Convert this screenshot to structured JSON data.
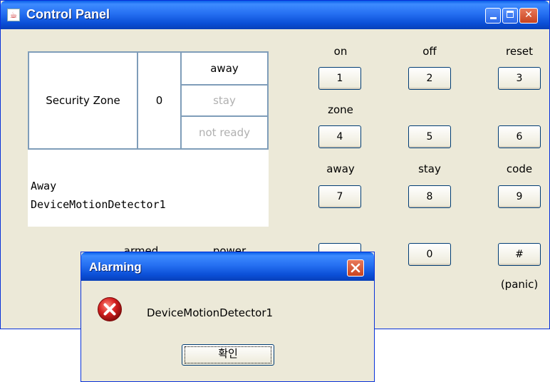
{
  "window": {
    "title": "Control Panel",
    "app_icon": "java-cup-icon"
  },
  "status": {
    "zone_label": "Security Zone",
    "zone_number": "0",
    "away": "away",
    "stay": "stay",
    "not_ready": "not ready",
    "message_line1": "Away",
    "message_line2": "DeviceMotionDetector1",
    "armed_label": "armed",
    "power_label": "power"
  },
  "keypad": {
    "labels": {
      "on": "on",
      "off": "off",
      "reset": "reset",
      "zone": "zone",
      "away": "away",
      "stay": "stay",
      "code": "code",
      "panic": "(panic)"
    },
    "keys": {
      "k1": "1",
      "k2": "2",
      "k3": "3",
      "k4": "4",
      "k5": "5",
      "k6": "6",
      "k7": "7",
      "k8": "8",
      "k9": "9",
      "k0": "0",
      "hash": "#"
    }
  },
  "dialog": {
    "title": "Alarming",
    "message": "DeviceMotionDetector1",
    "ok_label": "확인",
    "icon": "error-icon"
  },
  "colors": {
    "titlebar": "#2670f2",
    "window_bg": "#ece9d8",
    "error_red": "#d42020"
  }
}
